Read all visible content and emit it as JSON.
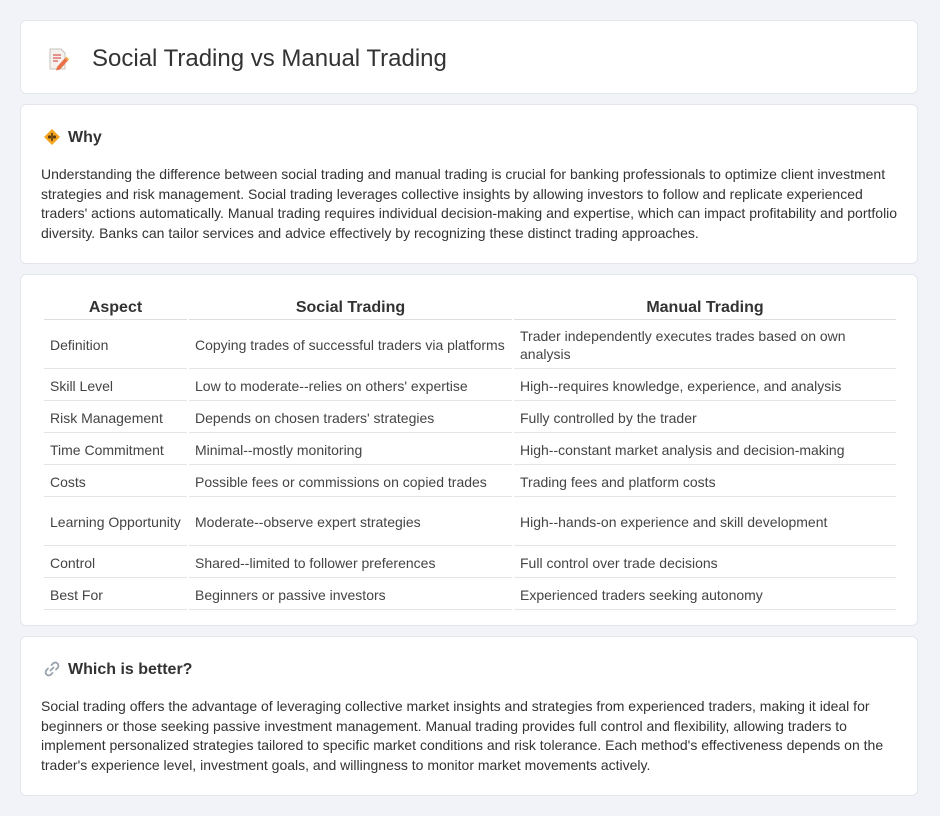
{
  "header": {
    "title": "Social Trading vs Manual Trading",
    "icon": "document-pencil-icon"
  },
  "why": {
    "title": "Why",
    "icon": "diamond-warning-icon",
    "text": "Understanding the difference between social trading and manual trading is crucial for banking professionals to optimize client investment strategies and risk management. Social trading leverages collective insights by allowing investors to follow and replicate experienced traders' actions automatically. Manual trading requires individual decision-making and expertise, which can impact profitability and portfolio diversity. Banks can tailor services and advice effectively by recognizing these distinct trading approaches."
  },
  "table": {
    "headers": [
      "Aspect",
      "Social Trading",
      "Manual Trading"
    ],
    "rows": [
      [
        "Definition",
        "Copying trades of successful traders via platforms",
        "Trader independently executes trades based on own analysis"
      ],
      [
        "Skill Level",
        "Low to moderate--relies on others' expertise",
        "High--requires knowledge, experience, and analysis"
      ],
      [
        "Risk Management",
        "Depends on chosen traders' strategies",
        "Fully controlled by the trader"
      ],
      [
        "Time Commitment",
        "Minimal--mostly monitoring",
        "High--constant market analysis and decision-making"
      ],
      [
        "Costs",
        "Possible fees or commissions on copied trades",
        "Trading fees and platform costs"
      ],
      [
        "Learning Opportunity",
        "Moderate--observe expert strategies",
        "High--hands-on experience and skill development"
      ],
      [
        "Control",
        "Shared--limited to follower preferences",
        "Full control over trade decisions"
      ],
      [
        "Best For",
        "Beginners or passive investors",
        "Experienced traders seeking autonomy"
      ]
    ]
  },
  "better": {
    "title": "Which is better?",
    "icon": "link-icon",
    "text": "Social trading offers the advantage of leveraging collective market insights and strategies from experienced traders, making it ideal for beginners or those seeking passive investment management. Manual trading provides full control and flexibility, allowing traders to implement personalized strategies tailored to specific market conditions and risk tolerance. Each method's effectiveness depends on the trader's experience level, investment goals, and willingness to monitor market movements actively."
  },
  "colors": {
    "background": "#f1f3f8",
    "card": "#ffffff",
    "text": "#333333",
    "accent_orange": "#f0a030"
  }
}
